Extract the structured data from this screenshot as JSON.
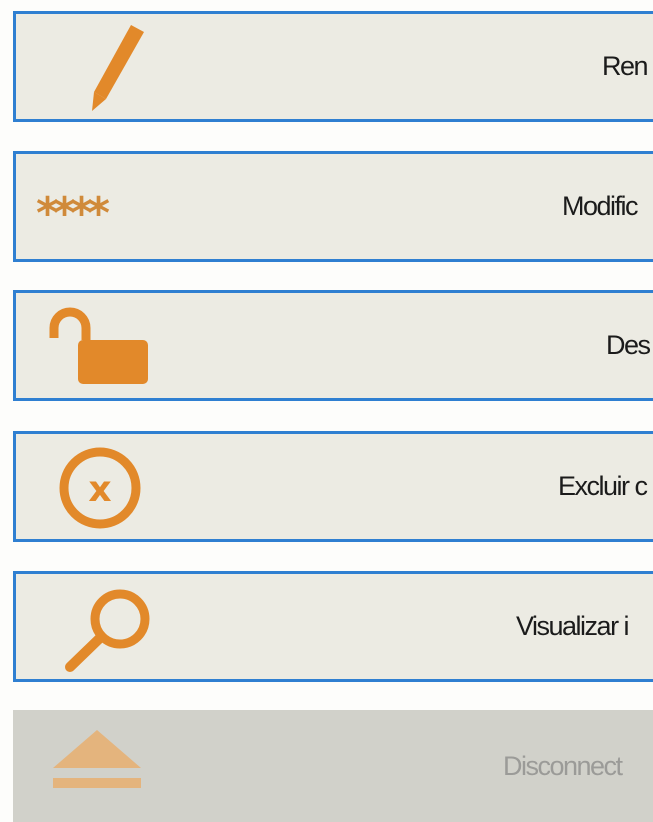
{
  "actions": {
    "rename_label": "Ren",
    "modify_label": "Modific",
    "unlock_label": "Des",
    "delete_label": "Excluir c",
    "view_label": "Visualizar i",
    "disconnect_label": "Disconnect"
  },
  "password_mask": "****",
  "icons": {
    "rename": "pencil-icon",
    "modify": "asterisks-icon",
    "unlock": "unlock-icon",
    "delete": "circle-x-icon",
    "view": "magnifier-icon",
    "disconnect": "eject-icon"
  },
  "colors": {
    "icon": "#e2892a",
    "icon_disabled": "#e4b47d",
    "border": "#2f7fd1",
    "button_bg": "#ecebe3",
    "disabled_bg": "#d1d1ca"
  }
}
